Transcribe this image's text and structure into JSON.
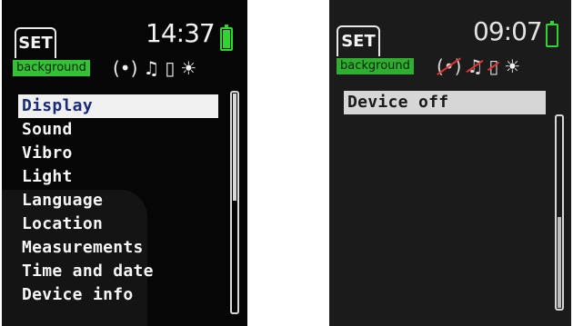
{
  "screens": [
    {
      "tab_label": "SET",
      "time": "14:37",
      "status_badge": "background",
      "icons": [
        "vibration-waves-icon",
        "music-note-icon",
        "vibro-icon",
        "brightness-icon"
      ],
      "menu": {
        "items": [
          "Display",
          "Sound",
          "Vibro",
          "Light",
          "Language",
          "Location",
          "Measurements",
          "Time and date",
          "Device info"
        ],
        "selected_index": 0
      },
      "battery_level": 1.0
    },
    {
      "tab_label": "SET",
      "time": "09:07",
      "status_badge": "background",
      "icons": [
        "vibration-waves-off-icon",
        "music-note-off-icon",
        "vibro-off-icon",
        "brightness-icon"
      ],
      "menu": {
        "items": [
          "Device off"
        ],
        "selected_index": 0
      },
      "battery_level": 0.0
    }
  ],
  "colors": {
    "accent_green": "#35c135",
    "selected_text": "#1a2c78",
    "off_marker": "#e33535"
  }
}
